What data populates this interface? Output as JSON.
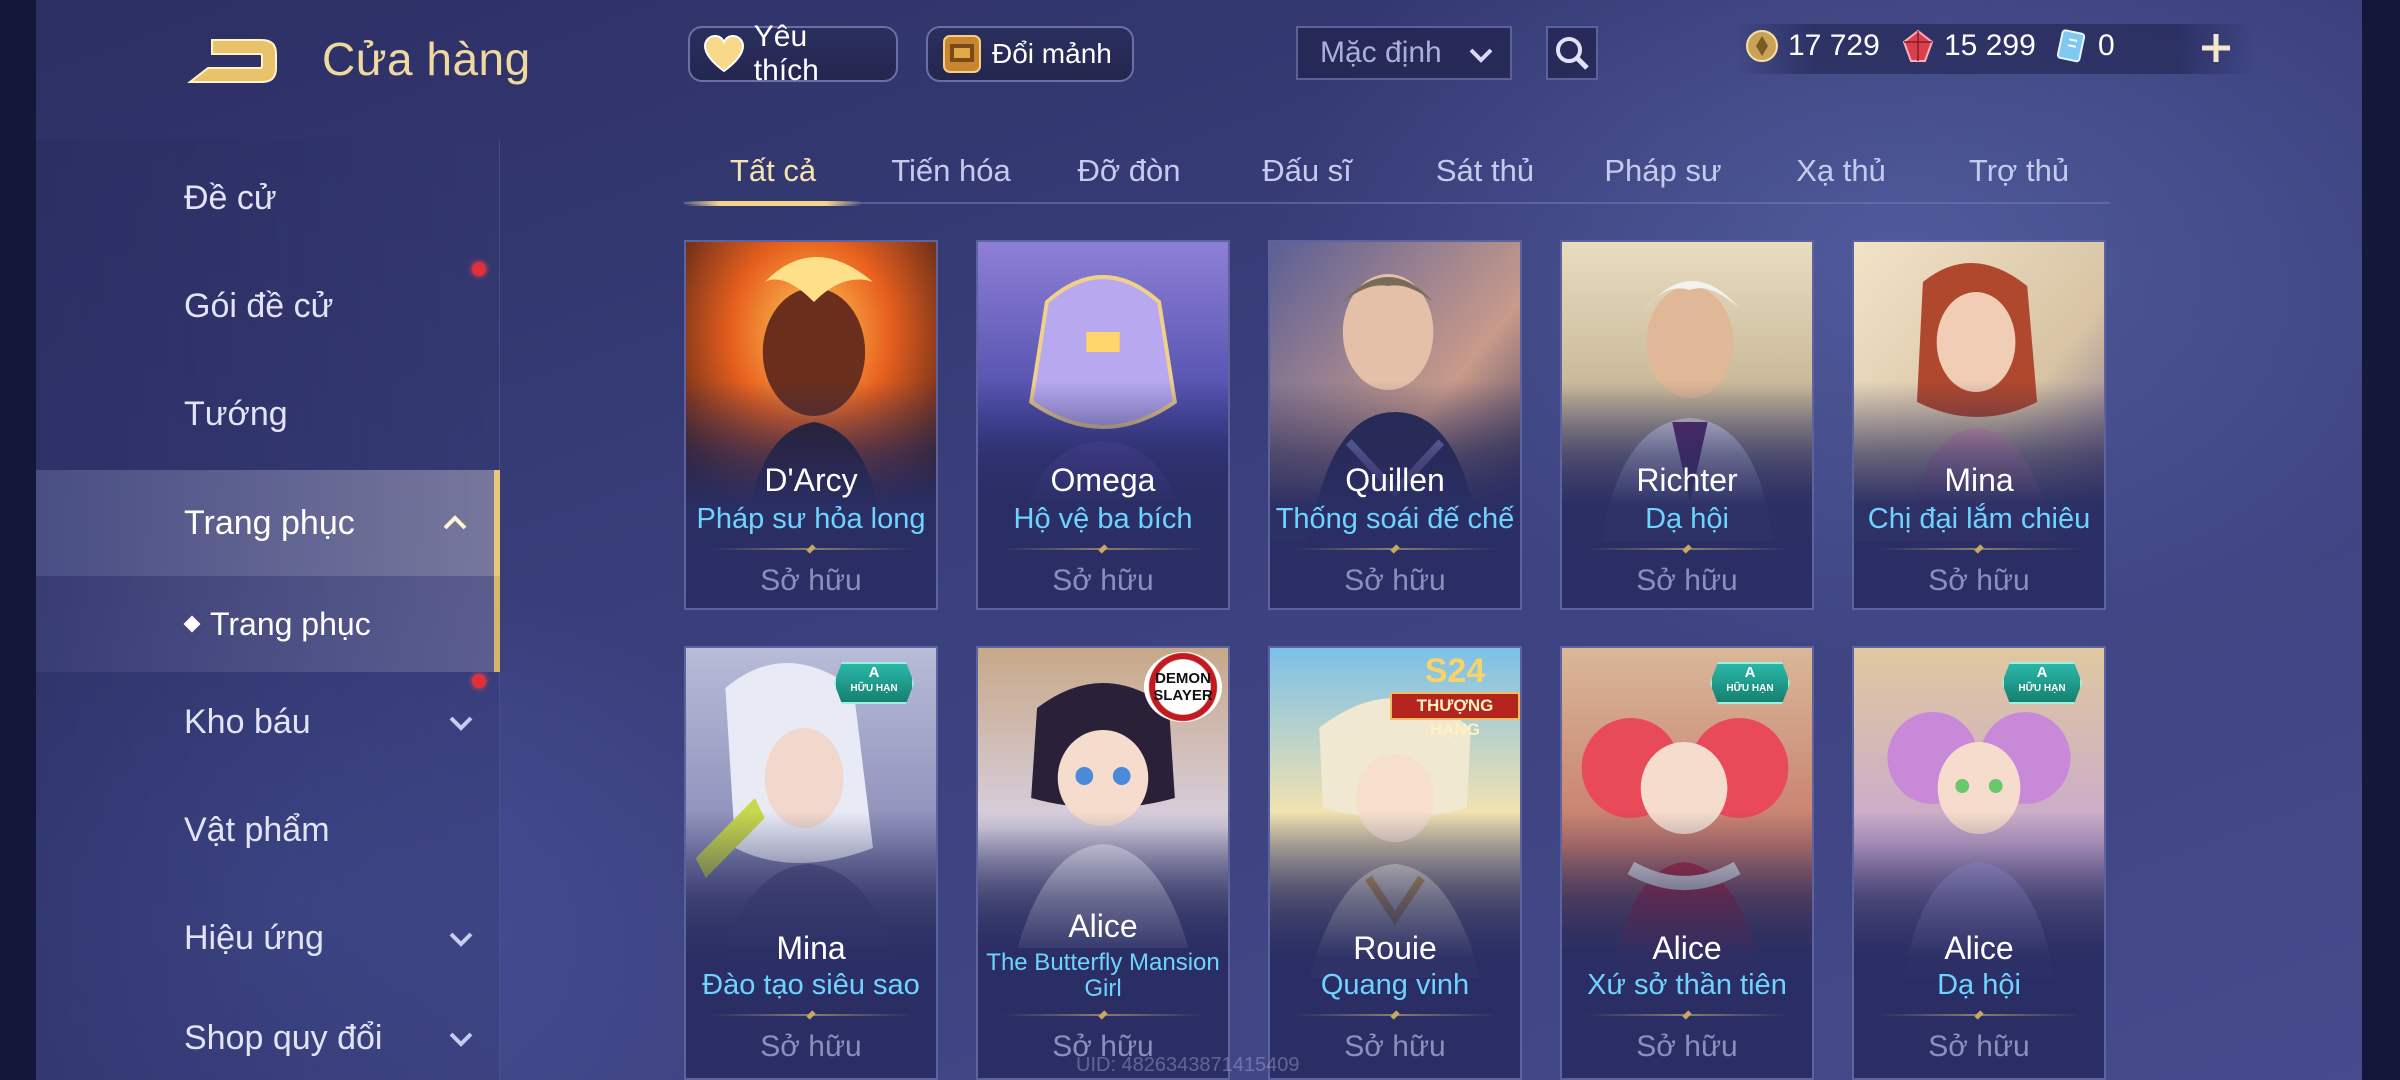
{
  "header": {
    "title": "Cửa hàng",
    "favorite_label": "Yêu thích",
    "shard_label": "Đổi mảnh",
    "sort_value": "Mặc định"
  },
  "currency": {
    "gold": "17 729",
    "ruby": "15 299",
    "ticket": "0"
  },
  "sidebar": {
    "items": [
      {
        "label": "Đề cử"
      },
      {
        "label": "Gói đề cử"
      },
      {
        "label": "Tướng"
      },
      {
        "label": "Trang phục"
      },
      {
        "label": "Kho báu"
      },
      {
        "label": "Vật phẩm"
      },
      {
        "label": "Hiệu ứng"
      },
      {
        "label": "Shop quy đổi"
      }
    ],
    "sub_item": "Trang phục"
  },
  "tabs": [
    "Tất cả",
    "Tiến hóa",
    "Đỡ đòn",
    "Đấu sĩ",
    "Sát thủ",
    "Pháp sư",
    "Xạ thủ",
    "Trợ thủ"
  ],
  "cards": [
    {
      "hero": "D'Arcy",
      "skin": "Pháp sư hỏa long",
      "status": "Sở hữu"
    },
    {
      "hero": "Omega",
      "skin": "Hộ vệ ba bích",
      "status": "Sở hữu"
    },
    {
      "hero": "Quillen",
      "skin": "Thống soái đế chế",
      "status": "Sở hữu"
    },
    {
      "hero": "Richter",
      "skin": "Dạ hội",
      "status": "Sở hữu"
    },
    {
      "hero": "Mina",
      "skin": "Chị đại lắm chiêu",
      "status": "Sở hữu"
    },
    {
      "hero": "Mina",
      "skin": "Đào tạo siêu sao",
      "status": "Sở hữu",
      "badge_grade": "A",
      "badge_text": "HỮU HẠN"
    },
    {
      "hero": "Alice",
      "skin": "The Butterfly Mansion Girl",
      "status": "Sở hữu",
      "badge_text": "DEMON SLAYER"
    },
    {
      "hero": "Rouie",
      "skin": "Quang vinh",
      "status": "Sở hữu",
      "badge_season": "S24",
      "badge_text": "THƯỢNG HẠNG"
    },
    {
      "hero": "Alice",
      "skin": "Xứ sở thần tiên",
      "status": "Sở hữu",
      "badge_grade": "A",
      "badge_text": "HỮU HẠN"
    },
    {
      "hero": "Alice",
      "skin": "Dạ hội",
      "status": "Sở hữu",
      "badge_grade": "A",
      "badge_text": "HỮU HẠN"
    }
  ],
  "uid": "UID: 4826343871415409",
  "colors": {
    "accent_gold": "#f2d48a",
    "skin_name": "#6fd3ff",
    "notification_dot": "#e0303c",
    "owned_text": "#8a8fbc"
  }
}
